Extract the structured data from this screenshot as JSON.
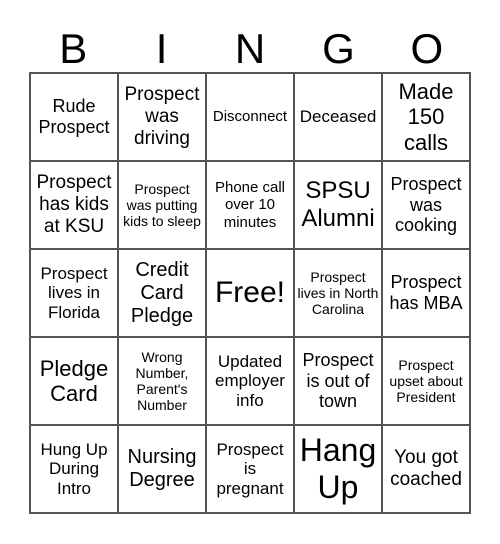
{
  "header": [
    "B",
    "I",
    "N",
    "G",
    "O"
  ],
  "cells": [
    "Rude Prospect",
    "Prospect was driving",
    "Disconnect",
    "Deceased",
    "Made 150 calls",
    "Prospect has kids at KSU",
    "Prospect was putting kids to sleep",
    "Phone call over 10 minutes",
    "SPSU Alumni",
    "Prospect was cooking",
    "Prospect lives in Florida",
    "Credit Card Pledge",
    "Free!",
    "Prospect lives in North Carolina",
    "Prospect has MBA",
    "Pledge Card",
    "Wrong Number, Parent's Number",
    "Updated employer info",
    "Prospect is out of town",
    "Prospect upset about President",
    "Hung Up During Intro",
    "Nursing Degree",
    "Prospect is pregnant",
    "Hang Up",
    "You got coached"
  ]
}
